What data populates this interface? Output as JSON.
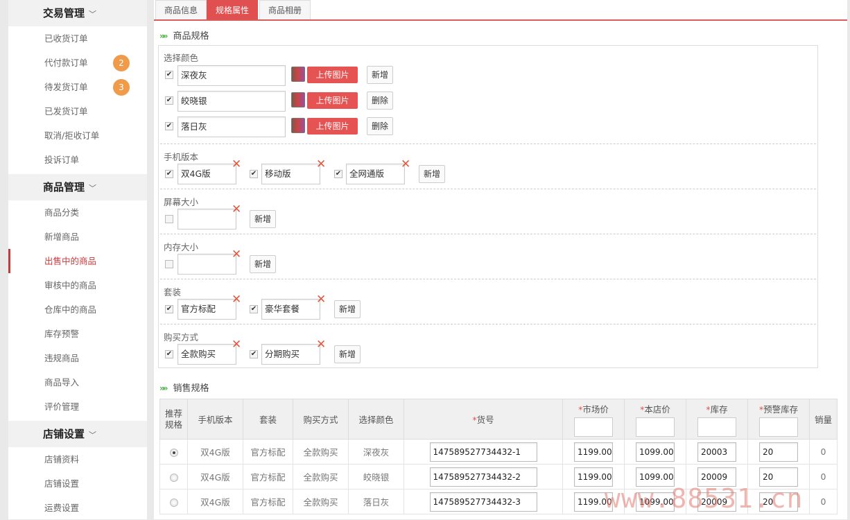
{
  "sidebar": {
    "groups": [
      {
        "title": "交易管理",
        "items": [
          "已收货订单",
          "代付款订单",
          "待发货订单",
          "已发货订单",
          "取消/拒收订单",
          "投诉订单"
        ],
        "badges": {
          "1": "2",
          "2": "3"
        }
      },
      {
        "title": "商品管理",
        "items": [
          "商品分类",
          "新增商品",
          "出售中的商品",
          "审核中的商品",
          "仓库中的商品",
          "库存预警",
          "违规商品",
          "商品导入",
          "评价管理"
        ]
      },
      {
        "title": "店铺设置",
        "items": [
          "店铺资料",
          "店铺设置",
          "运费设置"
        ]
      }
    ],
    "active_item": "出售中的商品"
  },
  "tabs": [
    "商品信息",
    "规格属性",
    "商品相册"
  ],
  "active_tab": "规格属性",
  "spec_section_title": "商品规格",
  "sale_section_title": "销售规格",
  "color_group": {
    "label": "选择颜色",
    "rows": [
      {
        "value": "深夜灰",
        "checked": true,
        "upload": "上传图片",
        "action": "新增"
      },
      {
        "value": "皎晓银",
        "checked": true,
        "upload": "上传图片",
        "action": "删除"
      },
      {
        "value": "落日灰",
        "checked": true,
        "upload": "上传图片",
        "action": "删除"
      }
    ]
  },
  "option_groups": [
    {
      "label": "手机版本",
      "values": [
        {
          "v": "双4G版",
          "c": true
        },
        {
          "v": "移动版",
          "c": true
        },
        {
          "v": "全网通版",
          "c": true
        }
      ],
      "add": "新增"
    },
    {
      "label": "屏幕大小",
      "values": [
        {
          "v": "",
          "c": false
        }
      ],
      "add": "新增"
    },
    {
      "label": "内存大小",
      "values": [
        {
          "v": "",
          "c": false
        }
      ],
      "add": "新增"
    },
    {
      "label": "套装",
      "values": [
        {
          "v": "官方标配",
          "c": true
        },
        {
          "v": "豪华套餐",
          "c": true
        }
      ],
      "add": "新增"
    },
    {
      "label": "购买方式",
      "values": [
        {
          "v": "全款购买",
          "c": true
        },
        {
          "v": "分期购买",
          "c": true
        }
      ],
      "add": "新增"
    }
  ],
  "table": {
    "headers": [
      "推荐规格",
      "手机版本",
      "套装",
      "购买方式",
      "选择颜色",
      "货号",
      "市场价",
      "本店价",
      "库存",
      "预警库存",
      "销量"
    ],
    "required_mark": "*",
    "rows": [
      {
        "rec": true,
        "version": "双4G版",
        "pack": "官方标配",
        "pay": "全款购买",
        "color": "深夜灰",
        "sku": "147589527734432-1",
        "market": "1199.00",
        "price": "1099.00",
        "stock": "20003",
        "warn": "20",
        "sales": "0"
      },
      {
        "rec": false,
        "version": "双4G版",
        "pack": "官方标配",
        "pay": "全款购买",
        "color": "皎晓银",
        "sku": "147589527734432-2",
        "market": "1199.00",
        "price": "1099.00",
        "stock": "20009",
        "warn": "20",
        "sales": "0"
      },
      {
        "rec": false,
        "version": "双4G版",
        "pack": "官方标配",
        "pay": "全款购买",
        "color": "落日灰",
        "sku": "147589527734432-3",
        "market": "1199.00",
        "price": "1099.00",
        "stock": "20009",
        "warn": "20",
        "sales": "0"
      }
    ]
  },
  "watermark": "www.88531.cn"
}
